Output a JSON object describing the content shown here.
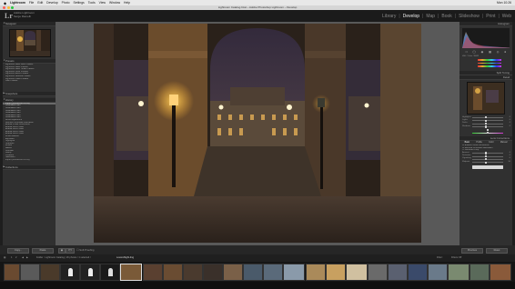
{
  "menubar": {
    "app": "Lightroom",
    "items": [
      "File",
      "Edit",
      "Develop",
      "Photo",
      "Settings",
      "Tools",
      "View",
      "Window",
      "Help"
    ],
    "clock": "Mon 10:26"
  },
  "window": {
    "title": "Lightroom Catalog.lrcat – Adobe Photoshop Lightroom – Develop"
  },
  "identity": {
    "logo": "Lr",
    "line1": "Adobe Lightroom",
    "line2": "Serge Ramelli"
  },
  "modules": {
    "library": "Library",
    "develop": "Develop",
    "map": "Map",
    "book": "Book",
    "slideshow": "Slideshow",
    "print": "Print",
    "web": "Web",
    "sep": "|"
  },
  "left_panel": {
    "navigator": "Navigator",
    "presets": "Presets",
    "preset_items": [
      "Lightroom B&W Filter Presets",
      "Lightroom B&W Presets",
      "Lightroom B&W Toned Presets",
      "Lightroom Color Presets",
      "Lightroom Effect Presets",
      "Lightroom General Presets",
      "Lightroom Video Presets",
      "User Presets"
    ],
    "snapshots": "Snapshots",
    "history": "History",
    "history_items": [
      "Import (10/03/2016 14:35)",
      "Graduated Filter",
      "Graduated Filter",
      "Graduated Filter",
      "Graduated Filter",
      "Graduated Filter",
      "Graduated Filter",
      "Brush Adjustment",
      "Remove Chromatic Aberration",
      "Enable Profile Corrections",
      "Enable Lens Profile",
      "Enable Lens Profile",
      "Enable Lens Profile",
      "Enable Lens Profile",
      "White Balance",
      "Exposure",
      "Highlights",
      "Shadows",
      "Whites",
      "Blacks",
      "Contrast",
      "Clarity",
      "Vibrance",
      "Saturation",
      "Import (10/03/2016 14:35)"
    ],
    "collections": "Collections",
    "copy_btn": "Copy...",
    "paste_btn": "Paste"
  },
  "toolbar": {
    "soft_proofing": "Soft Proofing"
  },
  "right_panel": {
    "histogram": "Histogram",
    "original": "Original Photo",
    "basic": "Basic",
    "tone_curve": "Tone Curve",
    "hsl": "HSL / Color / B&W",
    "split_toning": "Split Toning",
    "detail": "Detail",
    "lens": "Lens Corrections",
    "lens_tabs": [
      "Basic",
      "Profile",
      "Color",
      "Manual"
    ],
    "enable_profile": "Enable Profile Corrections",
    "remove_ca": "Remove Chromatic Aberration",
    "constrain": "Constrain Crop",
    "sliders": [
      {
        "label": "Highlights",
        "value": "0"
      },
      {
        "label": "Lights",
        "value": "0"
      },
      {
        "label": "Darks",
        "value": "0"
      },
      {
        "label": "Shadows",
        "value": "0"
      }
    ],
    "lens_sliders": [
      {
        "label": "Amount",
        "value": "0"
      },
      {
        "label": "Distortion",
        "value": "0"
      },
      {
        "label": "Vignetting",
        "value": "0"
      },
      {
        "label": "Midpoint",
        "value": "50"
      }
    ],
    "previous_btn": "Previous",
    "reset_btn": "Reset"
  },
  "filmstrip": {
    "page_labels": [
      "1",
      "2"
    ],
    "path": "Folder : Lightroom Catalog  |  26 photos / 1 selected / ",
    "filename": "LouvreNight.dng",
    "filter": "Filter :",
    "filter_value": "Filters Off"
  },
  "colors": {
    "accent": "#e6e6e6",
    "panel": "#303030",
    "background": "#595959",
    "history_selected": "#6a6a6a"
  }
}
